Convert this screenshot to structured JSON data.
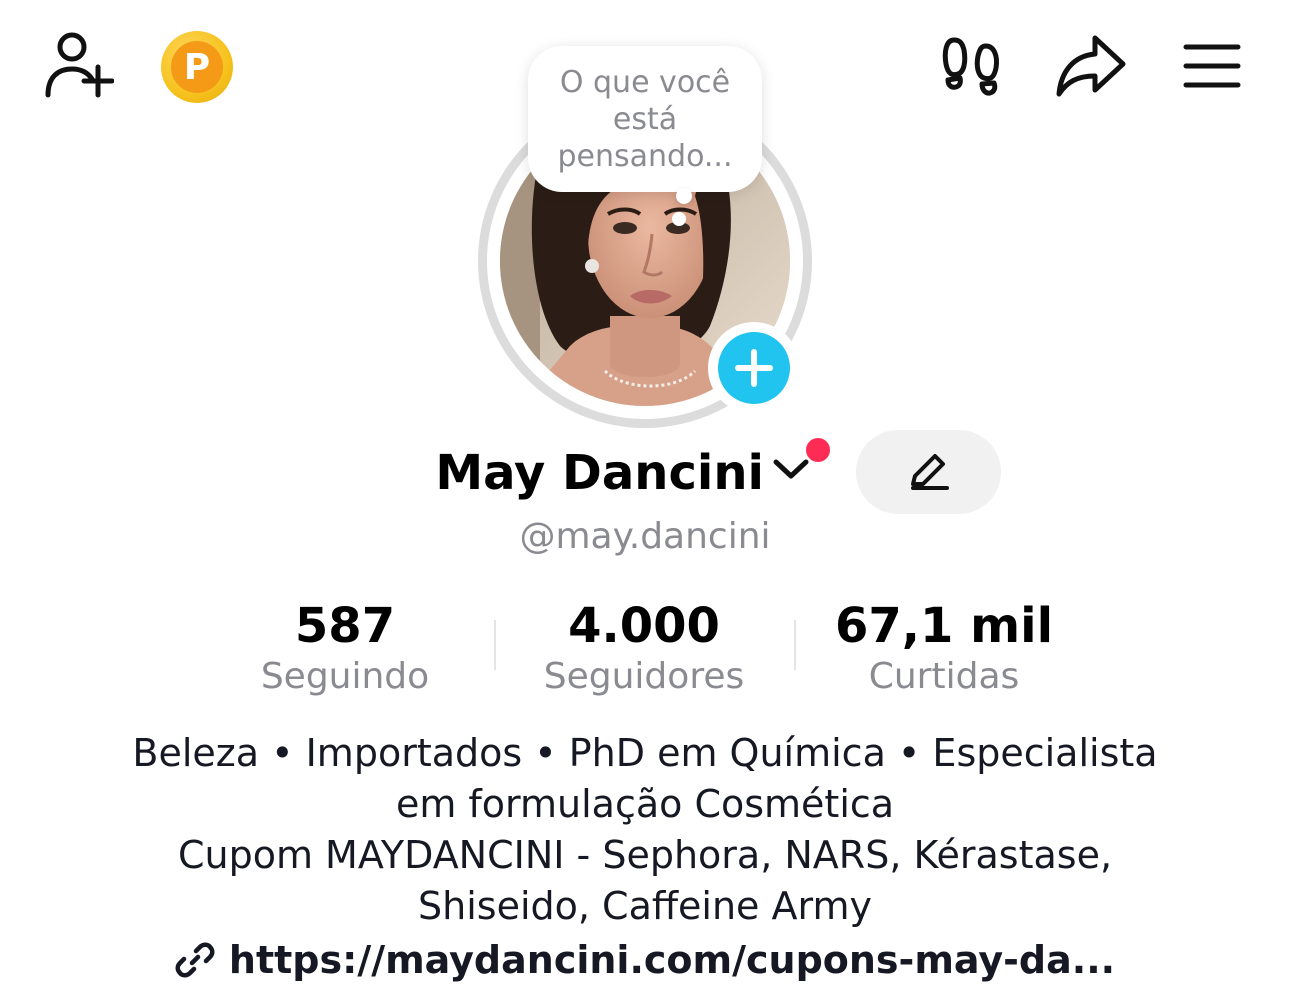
{
  "header": {
    "add_friend_icon": "person-plus-icon",
    "coin_letter": "P",
    "footprints_icon": "footprints-icon",
    "share_icon": "share-arrow-icon",
    "menu_icon": "hamburger-menu-icon"
  },
  "bubble": {
    "line1": "O que você",
    "line2": "está",
    "line3": "pensando..."
  },
  "profile": {
    "name": "May Dancini",
    "handle": "@may.dancini",
    "accent_add": "#20c4ee",
    "notification_dot": "#fe2c55"
  },
  "stats": [
    {
      "value": "587",
      "label": "Seguindo"
    },
    {
      "value": "4.000",
      "label": "Seguidores"
    },
    {
      "value": "67,1 mil",
      "label": "Curtidas"
    }
  ],
  "bio": {
    "line1": "Beleza • Importados • PhD em Química • Especialista",
    "line2": "em formulação Cosmética",
    "line3": "Cupom MAYDANCINI - Sephora, NARS, Kérastase,",
    "line4": "Shiseido, Caffeine Army",
    "link": "https://maydancini.com/cupons-may-da..."
  }
}
